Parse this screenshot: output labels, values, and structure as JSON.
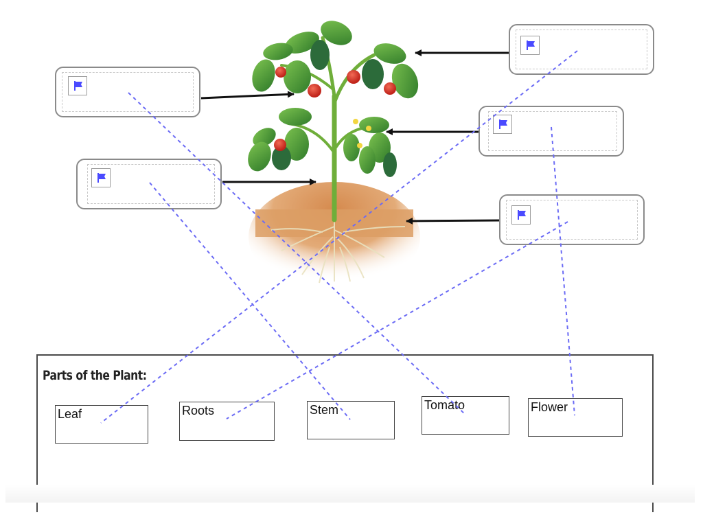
{
  "diagram": {
    "subject": "Tomato plant",
    "parts_shown": [
      "leaves",
      "tomatoes",
      "flowers",
      "stem",
      "roots",
      "soil"
    ]
  },
  "drop_zones": [
    {
      "id": "zone-left-1",
      "side": "left",
      "points_to": "tomato",
      "icon": "flag-icon",
      "value": ""
    },
    {
      "id": "zone-left-2",
      "side": "left",
      "points_to": "stem",
      "icon": "flag-icon",
      "value": ""
    },
    {
      "id": "zone-right-1",
      "side": "right",
      "points_to": "leaf",
      "icon": "flag-icon",
      "value": ""
    },
    {
      "id": "zone-right-2",
      "side": "right",
      "points_to": "flower",
      "icon": "flag-icon",
      "value": ""
    },
    {
      "id": "zone-right-3",
      "side": "right",
      "points_to": "roots",
      "icon": "flag-icon",
      "value": ""
    }
  ],
  "word_bank": {
    "title": "Parts of the Plant:",
    "labels": [
      "Leaf",
      "Roots",
      "Stem",
      "Tomato",
      "Flower"
    ]
  },
  "connections": [
    {
      "from": "zone-left-1",
      "to": "Tomato"
    },
    {
      "from": "zone-left-2",
      "to": "Stem"
    },
    {
      "from": "zone-right-1",
      "to": "Leaf"
    },
    {
      "from": "zone-right-2",
      "to": "Flower"
    },
    {
      "from": "zone-right-3",
      "to": "Roots"
    }
  ],
  "colors": {
    "flag": "#4a4aff",
    "connector": "#6b6bf5",
    "arrow": "#111111",
    "zone_border": "#8a8a8a",
    "leaf": "#4f9a34",
    "tomato": "#d8352a",
    "soil": "#d89a62",
    "flower": "#f2d640"
  }
}
